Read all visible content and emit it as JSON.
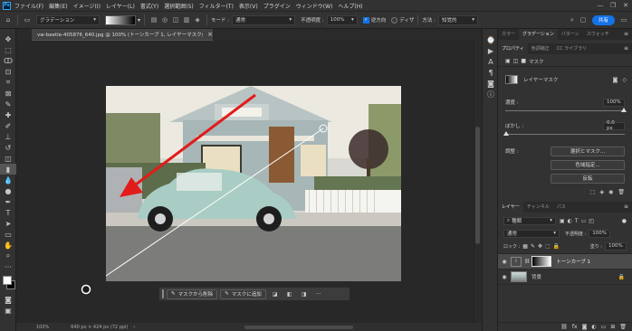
{
  "menubar": {
    "logo": "Ps",
    "items": [
      "ファイル(F)",
      "編集(E)",
      "イメージ(I)",
      "レイヤー(L)",
      "書式(Y)",
      "選択範囲(S)",
      "フィルター(T)",
      "表示(V)",
      "プラグイン",
      "ウィンドウ(W)",
      "ヘルプ(H)"
    ],
    "window_controls": [
      "—",
      "❐",
      "✕"
    ]
  },
  "options": {
    "preset_label": "グラデーション",
    "mode_label": "モード :",
    "mode_value": "通常",
    "opacity_label": "不透明度 :",
    "opacity_value": "100%",
    "reverse_label": "逆方向",
    "dither_label": "ディザ",
    "method_label": "方法 :",
    "method_value": "知覚的",
    "share_label": "共有"
  },
  "document": {
    "tab_title": "vw-beetle-405876_640.jpg @ 100% (トーンカーブ 1, レイヤーマスク/8) *",
    "tab_close": "×",
    "zoom": "100%",
    "dimensions": "640 px × 424 px (72 ppi)"
  },
  "context_bar": {
    "remove_mask": "マスクから削除",
    "add_mask": "マスクに追加",
    "more": "···"
  },
  "panels": {
    "top_tabs": [
      "カラー",
      "グラデーション",
      "パターン",
      "スウォッチ"
    ],
    "top_active": 1,
    "sub_tabs": [
      "プロパティ",
      "色調補正",
      "CC ライブラリ"
    ],
    "sub_active": 0,
    "mask_type_label": "マスク",
    "layer_mask_label": "レイヤーマスク",
    "density_label": "濃度 :",
    "density_value": "100%",
    "feather_label": "ぼかし :",
    "feather_value": "0.0 px",
    "refine_label": "調整 :",
    "select_mask_button": "選択とマスク...",
    "color_range_button": "色域指定...",
    "invert_button": "反転"
  },
  "layers": {
    "tabs": [
      "レイヤー",
      "チャンネル",
      "パス"
    ],
    "active_tab": 0,
    "filter_label": "種類",
    "blend_mode": "通常",
    "opacity_label": "不透明度 :",
    "opacity_value": "100%",
    "lock_label": "ロック :",
    "fill_label": "塗り :",
    "fill_value": "100%",
    "items": [
      {
        "name": "トーンカーブ 1"
      },
      {
        "name": "背景"
      }
    ]
  }
}
